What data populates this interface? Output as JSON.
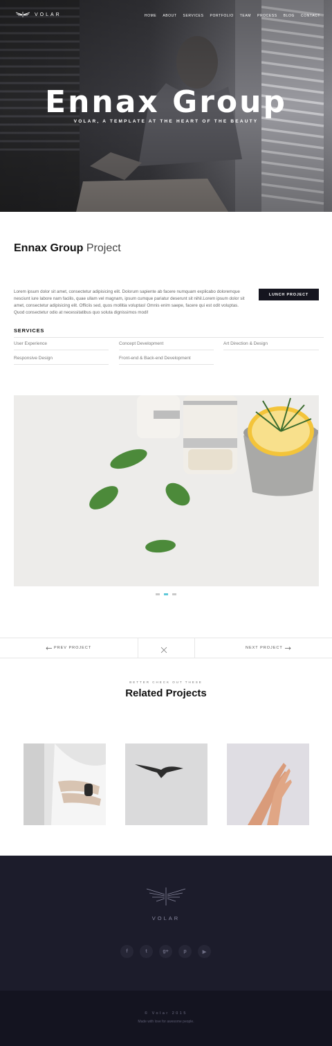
{
  "header": {
    "logo_text": "VOLAR",
    "nav": [
      "HOME",
      "ABOUT",
      "SERVICES",
      "PORTFOLIO",
      "TEAM",
      "PROCESS",
      "BLOG",
      "CONTACT"
    ]
  },
  "hero": {
    "title": "Ennax Group",
    "subtitle": "VOLAR, A TEMPLATE AT THE HEART OF THE BEAUTY"
  },
  "project": {
    "title_bold": "Ennax Group",
    "title_light": "Project",
    "description": "Lorem ipsum dolor sit amet, consectetur adipisicing elit. Dolorum sapiente ab facere numquam explicabo doloremque nesciunt iure labore nam facilis, quae ullam vel magnam, ipsum cumque pariatur deserunt sit nihil.Lorem ipsum dolor sit amet, consectetur adipisicing elit. Officiis sed, quos mollitia voluptas! Omnis enim saepe, facere qui est odit voluptas. Quod consectetur odio at necessitatibus quo soluta dignissimos modi!",
    "launch_label": "LUNCH PROJECT",
    "services_heading": "SERVICES",
    "services": [
      "User Experience",
      "Concept Development",
      "Art Direction & Design",
      "Responsive Design",
      "Front-end & Back-end Development"
    ]
  },
  "slider": {
    "count": 3,
    "active": 2
  },
  "project_nav": {
    "prev_label": "PREV PROJECT",
    "next_label": "NEXT PROJECT"
  },
  "related": {
    "kicker": "BETTER CHECK OUT THESE",
    "title_bold": "Related",
    "title_light": "Projects"
  },
  "footer": {
    "brand": "VOLAR",
    "social_icons": [
      "facebook-icon",
      "twitter-icon",
      "google-plus-icon",
      "pinterest-icon",
      "youtube-icon"
    ],
    "copyright": "© Volar 2015",
    "made_with": "Made with love for awesome people."
  },
  "colors": {
    "accent": "#5ec8d8",
    "dark": "#15151f",
    "footer": "#1c1c2b"
  }
}
